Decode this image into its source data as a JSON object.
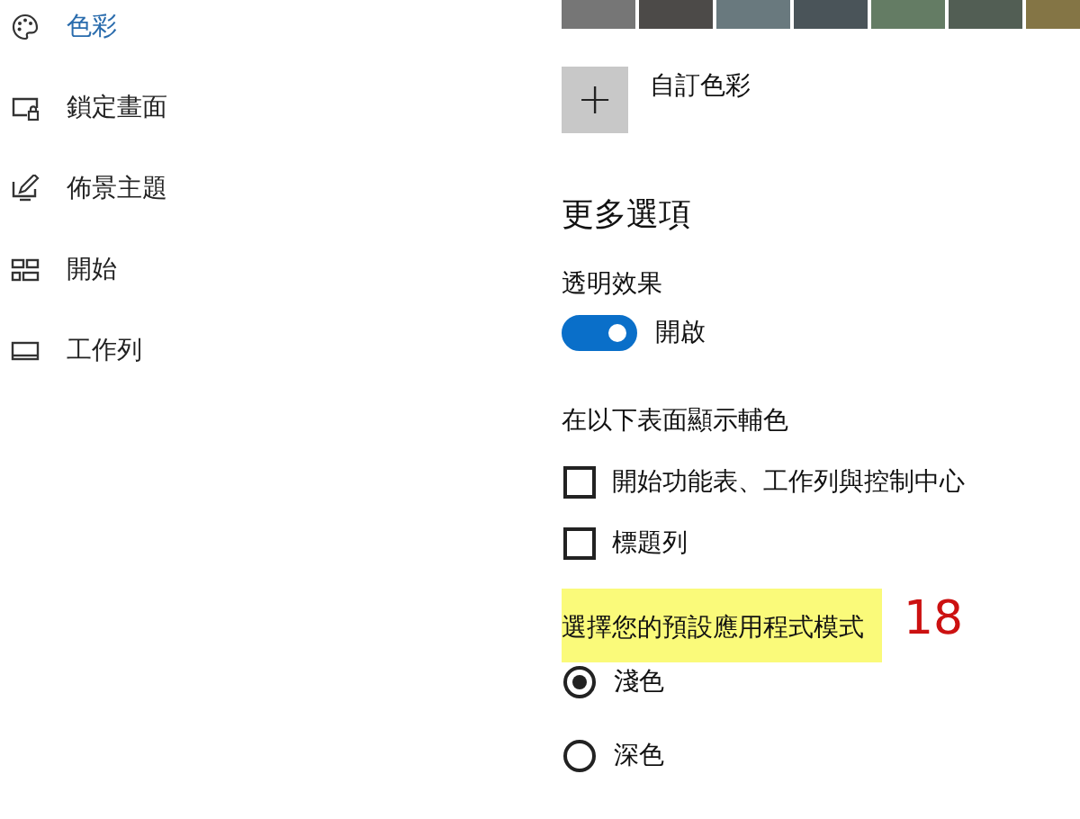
{
  "sidebar": {
    "items": [
      {
        "label": "色彩",
        "kind": "palette",
        "selected": true
      },
      {
        "label": "鎖定畫面",
        "kind": "lockscreen",
        "selected": false
      },
      {
        "label": "佈景主題",
        "kind": "theme",
        "selected": false
      },
      {
        "label": "開始",
        "kind": "start",
        "selected": false
      },
      {
        "label": "工作列",
        "kind": "taskbar",
        "selected": false
      }
    ]
  },
  "swatches": [
    {
      "color": "#767676",
      "selected": false
    },
    {
      "color": "#4c4a48",
      "selected": false
    },
    {
      "color": "#69797e",
      "selected": false
    },
    {
      "color": "#4a5459",
      "selected": false
    },
    {
      "color": "#647c64",
      "selected": false
    },
    {
      "color": "#525e54",
      "selected": false
    },
    {
      "color": "#847545",
      "selected": false
    }
  ],
  "custom_color": {
    "button": "+",
    "label": "自訂色彩"
  },
  "more_options": {
    "heading": "更多選項",
    "transparency": {
      "label": "透明效果",
      "on": true,
      "state_text": "開啟"
    },
    "accent_surfaces": {
      "label": "在以下表面顯示輔色",
      "options": [
        {
          "label": "開始功能表、工作列與控制中心",
          "checked": false
        },
        {
          "label": "標題列",
          "checked": false
        }
      ]
    },
    "app_mode": {
      "label": "選擇您的預設應用程式模式",
      "highlighted": true,
      "annotation": "18",
      "options": [
        {
          "label": "淺色",
          "selected": true
        },
        {
          "label": "深色",
          "selected": false
        }
      ]
    }
  }
}
